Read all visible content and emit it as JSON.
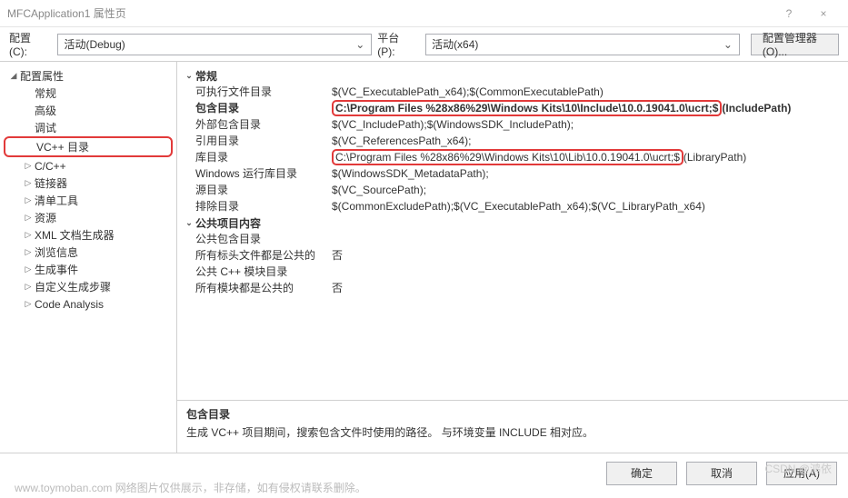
{
  "window": {
    "title": "MFCApplication1 属性页",
    "help_icon": "?",
    "close_icon": "×"
  },
  "toolbar": {
    "config_label": "配置(C):",
    "config_value": "活动(Debug)",
    "platform_label": "平台(P):",
    "platform_value": "活动(x64)",
    "manager_label": "配置管理器(O)..."
  },
  "sidebar": {
    "root": "配置属性",
    "items": [
      {
        "label": "常规",
        "exp": ""
      },
      {
        "label": "高级",
        "exp": ""
      },
      {
        "label": "调试",
        "exp": ""
      },
      {
        "label": "VC++ 目录",
        "exp": "",
        "selected": true
      },
      {
        "label": "C/C++",
        "exp": "▷"
      },
      {
        "label": "链接器",
        "exp": "▷"
      },
      {
        "label": "清单工具",
        "exp": "▷"
      },
      {
        "label": "资源",
        "exp": "▷"
      },
      {
        "label": "XML 文档生成器",
        "exp": "▷"
      },
      {
        "label": "浏览信息",
        "exp": "▷"
      },
      {
        "label": "生成事件",
        "exp": "▷"
      },
      {
        "label": "自定义生成步骤",
        "exp": "▷"
      },
      {
        "label": "Code Analysis",
        "exp": "▷"
      }
    ]
  },
  "grid": {
    "groups": [
      {
        "name": "常规",
        "rows": [
          {
            "key": "可执行文件目录",
            "val": "$(VC_ExecutablePath_x64);$(CommonExecutablePath)"
          },
          {
            "key": "包含目录",
            "selected": true,
            "val_hl": "C:\\Program Files %28x86%29\\Windows Kits\\10\\Include\\10.0.19041.0\\ucrt;$",
            "val_tail": "(IncludePath)"
          },
          {
            "key": "外部包含目录",
            "val": "$(VC_IncludePath);$(WindowsSDK_IncludePath);"
          },
          {
            "key": "引用目录",
            "val": "$(VC_ReferencesPath_x64);"
          },
          {
            "key": "库目录",
            "val_hl": "C:\\Program Files %28x86%29\\Windows Kits\\10\\Lib\\10.0.19041.0\\ucrt;$",
            "val_tail": "(LibraryPath)"
          },
          {
            "key": "Windows 运行库目录",
            "val": "$(WindowsSDK_MetadataPath);"
          },
          {
            "key": "源目录",
            "val": "$(VC_SourcePath);"
          },
          {
            "key": "排除目录",
            "val": "$(CommonExcludePath);$(VC_ExecutablePath_x64);$(VC_LibraryPath_x64)"
          }
        ]
      },
      {
        "name": "公共项目内容",
        "rows": [
          {
            "key": "公共包含目录",
            "val": ""
          },
          {
            "key": "所有标头文件都是公共的",
            "val": "否"
          },
          {
            "key": "公共 C++ 模块目录",
            "val": ""
          },
          {
            "key": "所有模块都是公共的",
            "val": "否"
          }
        ]
      }
    ]
  },
  "desc": {
    "title": "包含目录",
    "text": "生成 VC++ 项目期间，搜索包含文件时使用的路径。    与环境变量 INCLUDE 相对应。"
  },
  "footer": {
    "ok": "确定",
    "cancel": "取消",
    "apply": "应用(A)"
  },
  "watermarks": {
    "w1": "www.toymoban.com  网络图片仅供展示，非存储，如有侵权请联系删除。",
    "w2": "CSDN @鸿依"
  }
}
